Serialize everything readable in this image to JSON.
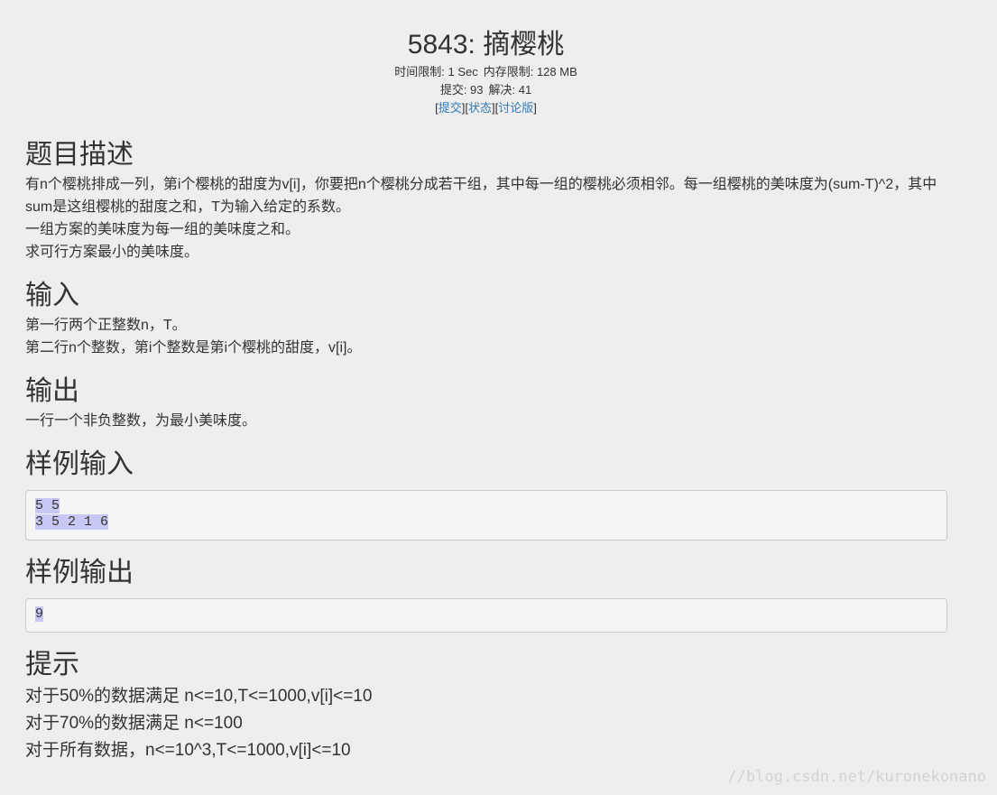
{
  "problem": {
    "title": "5843: 摘樱桃",
    "time_limit": "时间限制: 1 Sec",
    "memory_limit": "内存限制: 128 MB",
    "submits": "提交: 93",
    "solves": "解决: 41",
    "links": {
      "submit": "提交",
      "status": "状态",
      "discuss": "讨论版"
    }
  },
  "sections": {
    "description": {
      "heading": "题目描述",
      "lines": [
        "有n个樱桃排成一列，第i个樱桃的甜度为v[i]，你要把n个樱桃分成若干组，其中每一组的樱桃必须相邻。每一组樱桃的美味度为(sum-T)^2，其中sum是这组樱桃的甜度之和，T为输入给定的系数。",
        "一组方案的美味度为每一组的美味度之和。",
        "求可行方案最小的美味度。"
      ]
    },
    "input": {
      "heading": "输入",
      "lines": [
        "第一行两个正整数n，T。",
        "第二行n个整数，第i个整数是第i个樱桃的甜度，v[i]。"
      ]
    },
    "output": {
      "heading": "输出",
      "lines": [
        "一行一个非负整数，为最小美味度。"
      ]
    },
    "sample_input": {
      "heading": "样例输入",
      "lines": [
        "5 5",
        "3 5 2 1 6"
      ]
    },
    "sample_output": {
      "heading": "样例输出",
      "lines": [
        "9"
      ]
    },
    "hint": {
      "heading": "提示",
      "lines": [
        "对于50%的数据满足 n<=10,T<=1000,v[i]<=10",
        "对于70%的数据满足 n<=100",
        "对于所有数据，n<=10^3,T<=1000,v[i]<=10"
      ]
    }
  },
  "watermark": "//blog.csdn.net/kuronekonano"
}
